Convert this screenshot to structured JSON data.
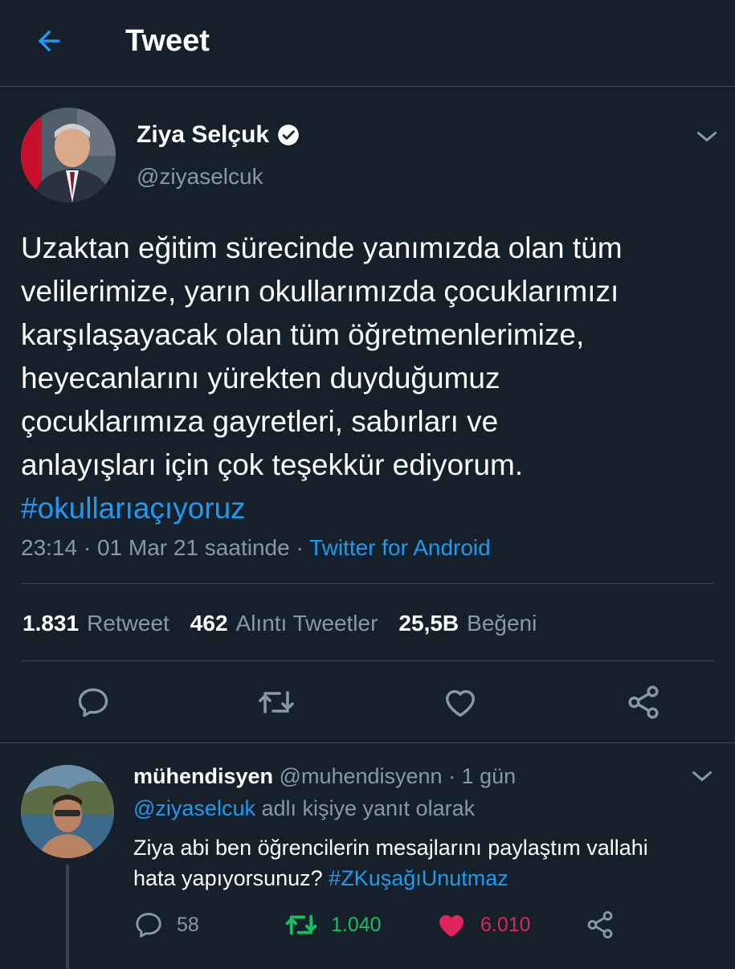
{
  "header": {
    "title": "Tweet",
    "back_icon": "arrow-left-icon"
  },
  "tweet": {
    "author": {
      "name": "Ziya Selçuk",
      "handle": "@ziyaselcuk",
      "verified_icon": "verified-badge-icon"
    },
    "text_lines": [
      "Uzaktan eğitim sürecinde yanımızda olan tüm",
      "velilerimize, yarın okullarımızda çocuklarımızı",
      "karşılaşayacak olan tüm öğretmenlerimize,",
      "heyecanlarını yürekten duyduğumuz",
      "çocuklarımıza gayretleri, sabırları ve",
      "anlayışları için çok teşekkür ediyorum."
    ],
    "hashtag": "#okullarıaçıyoruz",
    "meta": {
      "time_date": "23:14 · 01 Mar 21 saatinde · ",
      "source": "Twitter for Android"
    },
    "stats": [
      {
        "count": "1.831",
        "label": "Retweet"
      },
      {
        "count": "462",
        "label": "Alıntı Tweetler"
      },
      {
        "count": "25,5B",
        "label": "Beğeni"
      }
    ],
    "actions": [
      "reply-icon",
      "retweet-icon",
      "like-icon",
      "share-icon"
    ]
  },
  "reply": {
    "name": "mühendisyen",
    "handle_time": " @muhendisyenn · 1 gün",
    "reply_to_mention": "@ziyaselcuk",
    "reply_to_suffix": " adlı kişiye yanıt olarak",
    "text_line1": "Ziya abi ben öğrencilerin mesajlarını paylaştım vallahi",
    "text_line2_prefix": "hata yapıyorsunuz? ",
    "hashtag": "#ZKuşağıUnutmaz",
    "counts": {
      "replies": "58",
      "retweets": "1.040",
      "likes": "6.010"
    },
    "colors": {
      "retweeted": "#17bf63",
      "liked": "#e0245e",
      "muted": "#8899a6"
    }
  },
  "colors": {
    "background": "#15202b",
    "accent": "#1d9bf0",
    "secondary_text": "#8899a6",
    "divider": "#38444d"
  }
}
